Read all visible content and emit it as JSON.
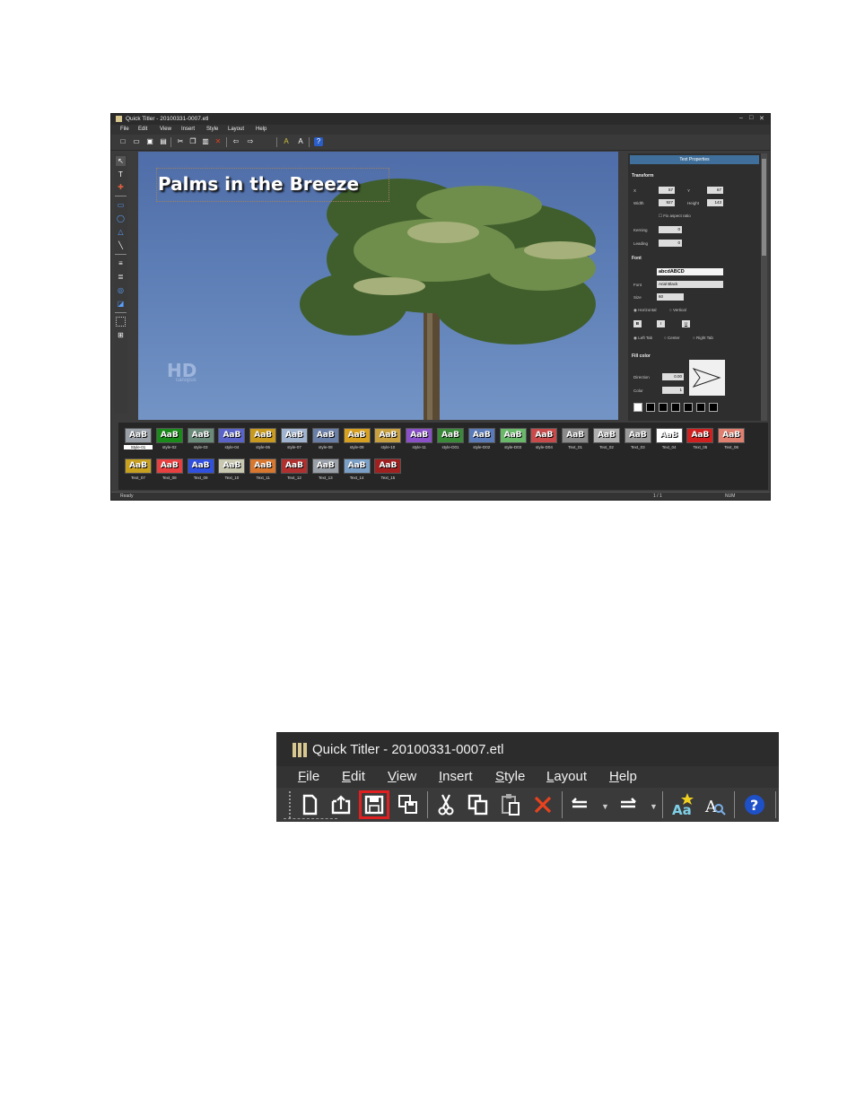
{
  "window": {
    "title": "Quick Titler - 20100331-0007.etl",
    "controls": [
      "–",
      "□",
      "✕"
    ]
  },
  "menu": [
    "File",
    "Edit",
    "View",
    "Insert",
    "Style",
    "Layout",
    "Help"
  ],
  "toolbar_icons": [
    "new-icon",
    "open-icon",
    "save-icon",
    "save-as-icon",
    "cut-icon",
    "copy-icon",
    "paste-icon",
    "delete-icon",
    "undo-icon",
    "redo-icon",
    "text-effect-icon",
    "font-icon",
    "help-icon"
  ],
  "canvas": {
    "title_text": "Palms in the Breeze",
    "watermark_text": "HD",
    "watermark_sub": "canopus"
  },
  "text_properties": {
    "header": "Text Properties",
    "transform": {
      "section": "Transform",
      "x_label": "X",
      "x_value": "57",
      "y_label": "Y",
      "y_value": "67",
      "width_label": "Width",
      "width_value": "927",
      "height_label": "Height",
      "height_value": "143",
      "fix_aspect": "Fix aspect ratio",
      "kerning_label": "Kerning",
      "kerning_value": "0",
      "leading_label": "Leading",
      "leading_value": "0"
    },
    "font": {
      "section": "Font",
      "preview": "abcdABCD",
      "font_label": "Font",
      "font_value": "Arial Black",
      "size_label": "Size",
      "size_value": "60",
      "horizontal": "Horizontal",
      "vertical": "Vertical",
      "bold": "B",
      "italic": "I",
      "underline": "U",
      "left_tab": "Left Tab",
      "center": "Center",
      "right_tab": "Right Tab"
    },
    "fill": {
      "section": "Fill color",
      "direction_label": "Direction",
      "direction_value": "0.00",
      "color_label": "Color",
      "color_value": "1"
    }
  },
  "styles": [
    {
      "label": "Style-01",
      "color": "#9aa0a8"
    },
    {
      "label": "style-02",
      "color": "#1a8a1a"
    },
    {
      "label": "style-03",
      "color": "#6a8a7a"
    },
    {
      "label": "style-04",
      "color": "#5a64c8"
    },
    {
      "label": "style-06",
      "color": "#c89a20"
    },
    {
      "label": "style-07",
      "color": "#a0b4d0"
    },
    {
      "label": "style-08",
      "color": "#6a7fa8"
    },
    {
      "label": "style-09",
      "color": "#d8a020"
    },
    {
      "label": "style-10",
      "color": "#c8a040"
    },
    {
      "label": "style-11",
      "color": "#8a50c8"
    },
    {
      "label": "style-D01",
      "color": "#3a8a3a"
    },
    {
      "label": "style-D02",
      "color": "#5a7ab8"
    },
    {
      "label": "style-D03",
      "color": "#6ab86a"
    },
    {
      "label": "style-D04",
      "color": "#c84a4a"
    },
    {
      "label": "Text_01",
      "color": "#8a8a8a"
    },
    {
      "label": "Text_02",
      "color": "#b0b0b0"
    },
    {
      "label": "Text_03",
      "color": "#9a9a9a"
    },
    {
      "label": "Text_04",
      "color": "#ffffff"
    },
    {
      "label": "Text_05",
      "color": "#d02020"
    },
    {
      "label": "Text_06",
      "color": "#e08070"
    },
    {
      "label": "Text_07",
      "color": "#c8a020"
    },
    {
      "label": "Text_08",
      "color": "#e84040"
    },
    {
      "label": "Text_09",
      "color": "#3050e0"
    },
    {
      "label": "Text_10",
      "color": "#c8c8b0"
    },
    {
      "label": "Text_11",
      "color": "#d87830"
    },
    {
      "label": "Text_12",
      "color": "#b03030"
    },
    {
      "label": "Text_13",
      "color": "#9aa0a8"
    },
    {
      "label": "Text_14",
      "color": "#7aa0c8"
    },
    {
      "label": "Text_15",
      "color": "#a02020"
    }
  ],
  "style_thumb_text": "AaB",
  "status": {
    "left": "Ready",
    "page": "1 / 1",
    "mode": "NUM"
  },
  "zoom": {
    "title": "Quick Titler - 20100331-0007.etl",
    "menu": [
      {
        "pre": "",
        "key": "F",
        "rest": "ile"
      },
      {
        "pre": "",
        "key": "E",
        "rest": "dit"
      },
      {
        "pre": "",
        "key": "V",
        "rest": "iew"
      },
      {
        "pre": "",
        "key": "I",
        "rest": "nsert"
      },
      {
        "pre": "",
        "key": "S",
        "rest": "tyle"
      },
      {
        "pre": "",
        "key": "L",
        "rest": "ayout"
      },
      {
        "pre": "",
        "key": "H",
        "rest": "elp"
      }
    ],
    "highlighted_tool": "save-icon",
    "highlight_color": "#e02020"
  }
}
